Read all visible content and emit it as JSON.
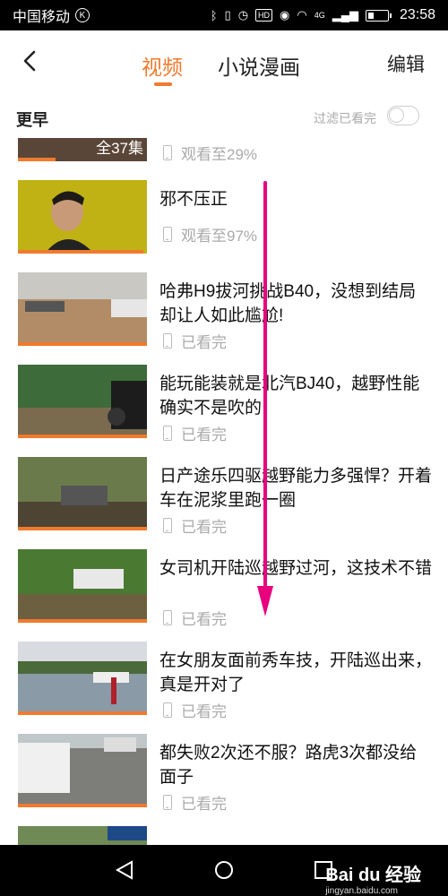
{
  "status_bar": {
    "carrier": "中国移动",
    "carrier_badge": "K",
    "network": "4G",
    "hd": "HD",
    "time": "23:58"
  },
  "header": {
    "back_icon": "chevron-left-icon",
    "tabs": [
      {
        "label": "视频",
        "active": true
      },
      {
        "label": "小说漫画",
        "active": false
      }
    ],
    "edit_label": "编辑"
  },
  "section": {
    "title": "更早",
    "filter_label": "过滤已看完",
    "filter_on": false
  },
  "items": [
    {
      "title": "",
      "meta": "观看至29%",
      "badge": "全37集",
      "progress": 0.29
    },
    {
      "title": "邪不压正",
      "meta": "观看至97%",
      "progress": 0.97
    },
    {
      "title": "哈弗H9拔河挑战B40，没想到结局却让人如此尴尬!",
      "meta": "已看完",
      "progress": 1
    },
    {
      "title": "能玩能装就是北汽BJ40，越野性能确实不是吹的",
      "meta": "已看完",
      "progress": 1
    },
    {
      "title": "日产途乐四驱越野能力多强悍？开着车在泥浆里跑一圈",
      "meta": "已看完",
      "progress": 1
    },
    {
      "title": "女司机开陆巡越野过河，这技术不错",
      "meta": "已看完",
      "progress": 1
    },
    {
      "title": "在女朋友面前秀车技，开陆巡出来，真是开对了",
      "meta": "已看完",
      "progress": 1
    },
    {
      "title": "都失败2次还不服？路虎3次都没给面子",
      "meta": "已看完",
      "progress": 1
    }
  ],
  "annotation": {
    "color": "#e8007d"
  },
  "watermark": {
    "brand": "Bai du 经验",
    "url": "jingyan.baidu.com"
  },
  "colors": {
    "accent": "#f07a2e"
  }
}
